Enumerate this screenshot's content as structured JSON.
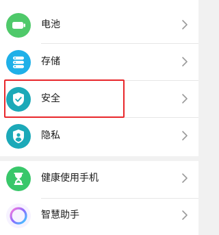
{
  "colors": {
    "battery_green": "#4fc96a",
    "storage_blue": "#1fb0e8",
    "security_teal": "#1ca9b8",
    "privacy_teal": "#1ca9b8",
    "wellbeing_green": "#39c76a",
    "highlight_red": "#e8262a"
  },
  "settings": {
    "items": [
      {
        "label": "电池",
        "icon": "battery-icon"
      },
      {
        "label": "存储",
        "icon": "storage-icon"
      },
      {
        "label": "安全",
        "icon": "shield-check-icon"
      },
      {
        "label": "隐私",
        "icon": "privacy-shield-icon"
      },
      {
        "label": "健康使用手机",
        "icon": "hourglass-icon"
      },
      {
        "label": "智慧助手",
        "icon": "assistant-ring-icon"
      }
    ]
  },
  "highlighted_item": "安全"
}
